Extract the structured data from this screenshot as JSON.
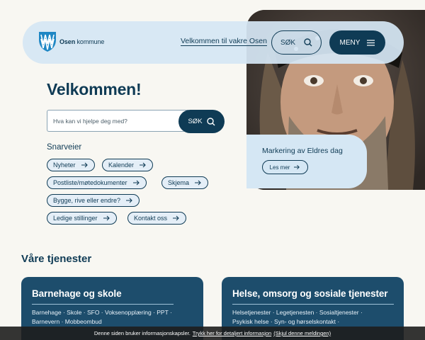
{
  "header": {
    "logo_bold": "Osen",
    "logo_rest": "kommune",
    "welcome_link": "Velkommen til vakre Osen",
    "search_label": "SØK",
    "menu_label": "MENY"
  },
  "hero": {
    "title": "Velkommen!",
    "search_placeholder": "Hva kan vi hjelpe deg med?",
    "search_button": "SØK"
  },
  "shortcuts": {
    "title": "Snarveier",
    "items": [
      "Nyheter",
      "Kalender",
      "Postliste/møtedokumenter",
      "Skjema",
      "Bygge, rive eller endre?",
      "Ledige stillinger",
      "Kontakt oss"
    ]
  },
  "promo": {
    "title": "Markering av Eldres dag",
    "button": "Les mer"
  },
  "services": {
    "title": "Våre tjenester",
    "cards": [
      {
        "title": "Barnehage og skole",
        "line1": "Barnehage · Skole · SFO · Voksenopplæring · PPT ·",
        "line2": "Barnevern · Mobbeombud"
      },
      {
        "title": "Helse, omsorg og sosiale tjenester",
        "line1": "Helsetjenester · Legetjenesten · Sosialtjenester ·",
        "line2": "Psykisk helse · Syn- og hørselskontakt ·"
      }
    ]
  },
  "cookie": {
    "text": "Denne siden bruker informasjonskapsler.",
    "details_link": "Trykk her for detaljert informasjon",
    "hide_link": "(Skjul denne meldingen)"
  },
  "colors": {
    "primary": "#0f3b55",
    "card": "#1d4d6c",
    "light": "#d5e7f4",
    "background": "#f8f7f2"
  }
}
